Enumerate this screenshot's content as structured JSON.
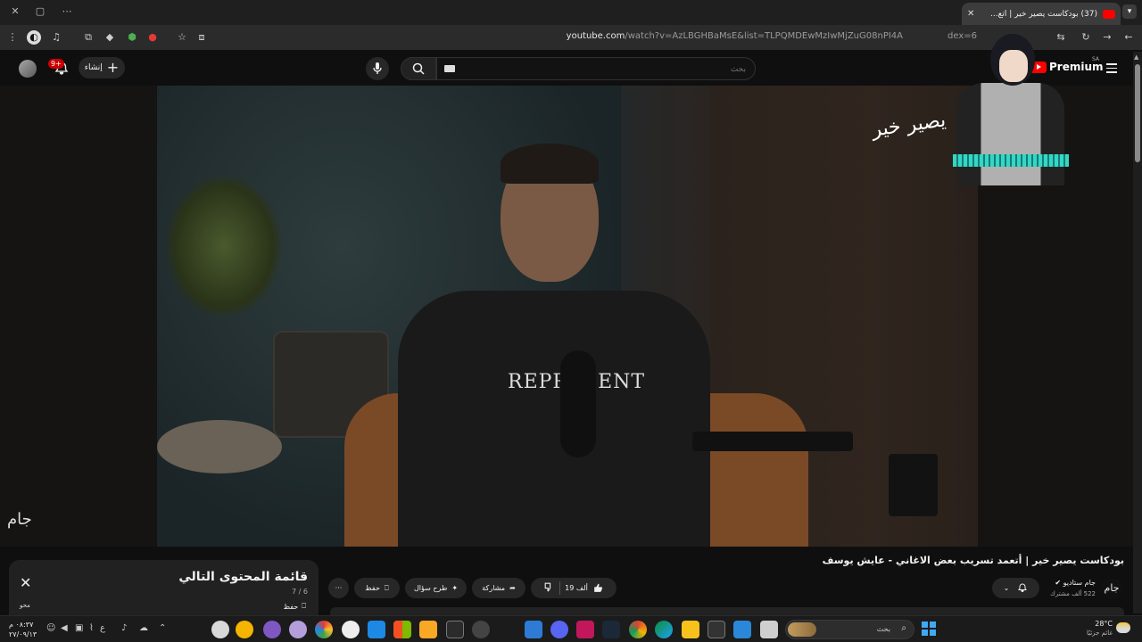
{
  "browser": {
    "tab_title": "(37) بودكاست يصير خير | أتع...",
    "new_tab": "+",
    "close_tab": "✕",
    "url_host": "youtube.com",
    "url_rest": "/watch?v=AzLBGHBaMsE&list=TLPQMDEwMzIwMjZuG08nPI4A",
    "url_tail": "dex=6"
  },
  "youtube": {
    "logo_text": "Premium",
    "logo_region": "SA",
    "search_placeholder": "بحث",
    "create_label": "إنشاء",
    "notif_count": "9+"
  },
  "video": {
    "overlay_logo": "يصير خير",
    "shirt_text": "REPRESENT",
    "watermark": "جام",
    "title": "بودكاست يصير خير | أتعمد تسريب بعض الاغاني - عايش يوسف"
  },
  "channel": {
    "avatar_text": "جام",
    "name": "جام ستاديو",
    "subscribers": "522 ألف مشترك"
  },
  "actions": {
    "likes": "19 ألف",
    "share": "مشاركة",
    "ask": "طرح سؤال",
    "save": "حفظ",
    "more": "···"
  },
  "playlist": {
    "title": "قائمة المحتوى التالي",
    "count": "7 / 6",
    "save": "حفظ",
    "clear": "محو",
    "close": "✕"
  },
  "taskbar": {
    "time": "٠٨:٣٧ م",
    "date": "٢٧/٠٩/١٣",
    "search_label": "بحث",
    "lang": "ع",
    "temp": "28°C",
    "weather_desc": "غائم جزئيًا"
  },
  "colors": {
    "background": "#0f0f0f",
    "brand_red": "#ff0000",
    "pill": "#272727"
  }
}
